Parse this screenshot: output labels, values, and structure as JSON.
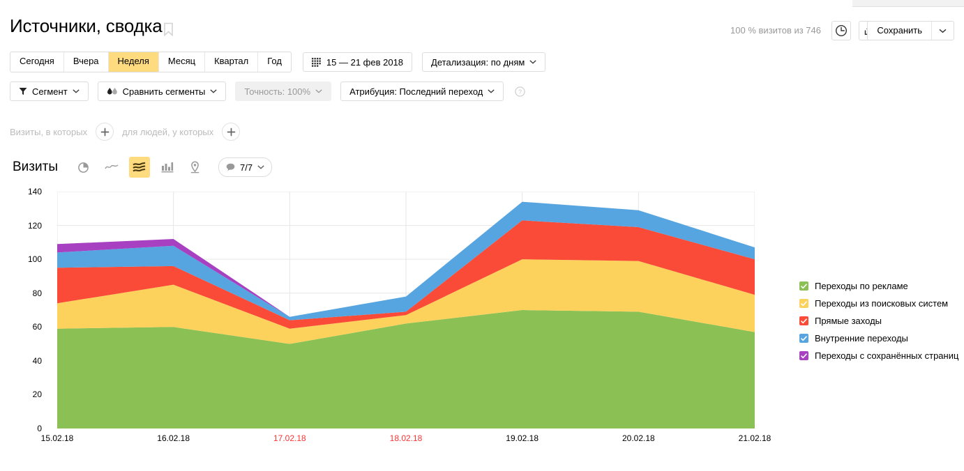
{
  "header": {
    "title": "Источники, сводка",
    "bookmark_icon": "bookmark-icon",
    "visits_summary": "100 % визитов из 746",
    "clock_icon": "clock-icon",
    "share_icon": "share-upload-icon",
    "save_label": "Сохранить",
    "save_arrow_icon": "chevron-down-icon"
  },
  "period_tabs": [
    {
      "label": "Сегодня",
      "active": false
    },
    {
      "label": "Вчера",
      "active": false
    },
    {
      "label": "Неделя",
      "active": true
    },
    {
      "label": "Месяц",
      "active": false
    },
    {
      "label": "Квартал",
      "active": false
    },
    {
      "label": "Год",
      "active": false
    }
  ],
  "date_range": {
    "icon": "calendar-grid-icon",
    "label": "15 — 21 фев 2018"
  },
  "detail": {
    "label": "Детализация: по дням",
    "icon": "chevron-down-icon"
  },
  "segment_row": {
    "segment": {
      "label": "Сегмент",
      "icon": "funnel-icon"
    },
    "compare": {
      "label": "Сравнить сегменты",
      "icon": "droplets-icon"
    },
    "accuracy": {
      "label": "Точность: 100%",
      "disabled": true
    },
    "attribution": {
      "label": "Атрибуция: Последний переход"
    },
    "help_icon": "question-circle-icon"
  },
  "filters_row": {
    "visits_label": "Визиты, в которых",
    "people_label": "для людей, у которых",
    "add_icon": "plus-icon"
  },
  "metric_row": {
    "title": "Визиты",
    "viz_buttons": [
      {
        "name": "pie-chart-icon",
        "active": false
      },
      {
        "name": "line-chart-icon",
        "active": false
      },
      {
        "name": "area-chart-icon",
        "active": true
      },
      {
        "name": "bar-chart-icon",
        "active": false
      },
      {
        "name": "map-pin-icon",
        "active": false
      }
    ],
    "count_pill": {
      "label": "7/7",
      "bubble_icon": "speech-bubble-icon",
      "arrow_icon": "chevron-down-icon"
    }
  },
  "colors": {
    "ads": "#8ac054",
    "search": "#fcd25d",
    "direct": "#fa4b38",
    "internal": "#56a5e0",
    "saved": "#a741c1",
    "ads_fill": "#90c464",
    "search_fill": "#fbd968",
    "direct_fill": "#f9533f",
    "internal_fill": "#5dabe3",
    "saved_fill": "#a94cc3",
    "accent": "#ffdb80",
    "weekend": "#ff3333",
    "grid": "#e6e6e6"
  },
  "chart_data": {
    "type": "area",
    "stacked": true,
    "title": "Визиты",
    "xlabel": "",
    "ylabel": "",
    "ylim": [
      0,
      140
    ],
    "yticks": [
      0,
      20,
      40,
      60,
      80,
      100,
      120,
      140
    ],
    "grid": true,
    "legend_position": "right",
    "categories": [
      "15.02.18",
      "16.02.18",
      "17.02.18",
      "18.02.18",
      "19.02.18",
      "20.02.18",
      "21.02.18"
    ],
    "weekend_categories": [
      "17.02.18",
      "18.02.18"
    ],
    "series": [
      {
        "name": "Переходы по рекламе",
        "color": "#8ac054",
        "checked": true,
        "values": [
          59,
          60,
          50,
          62,
          70,
          69,
          57
        ]
      },
      {
        "name": "Переходы из поисковых систем",
        "color": "#fcd25d",
        "checked": true,
        "values": [
          15,
          25,
          9,
          5,
          30,
          30,
          22
        ]
      },
      {
        "name": "Прямые заходы",
        "color": "#fa4b38",
        "checked": true,
        "values": [
          21,
          11,
          5,
          2,
          23,
          20,
          21
        ]
      },
      {
        "name": "Внутренние переходы",
        "color": "#56a5e0",
        "checked": true,
        "values": [
          9,
          12,
          2,
          9,
          11,
          10,
          7
        ]
      },
      {
        "name": "Переходы с сохранённых страниц",
        "color": "#a741c1",
        "checked": true,
        "values": [
          5,
          4,
          0,
          0,
          0,
          0,
          0
        ]
      }
    ],
    "totals": [
      109,
      112,
      66,
      78,
      134,
      129,
      107
    ]
  }
}
